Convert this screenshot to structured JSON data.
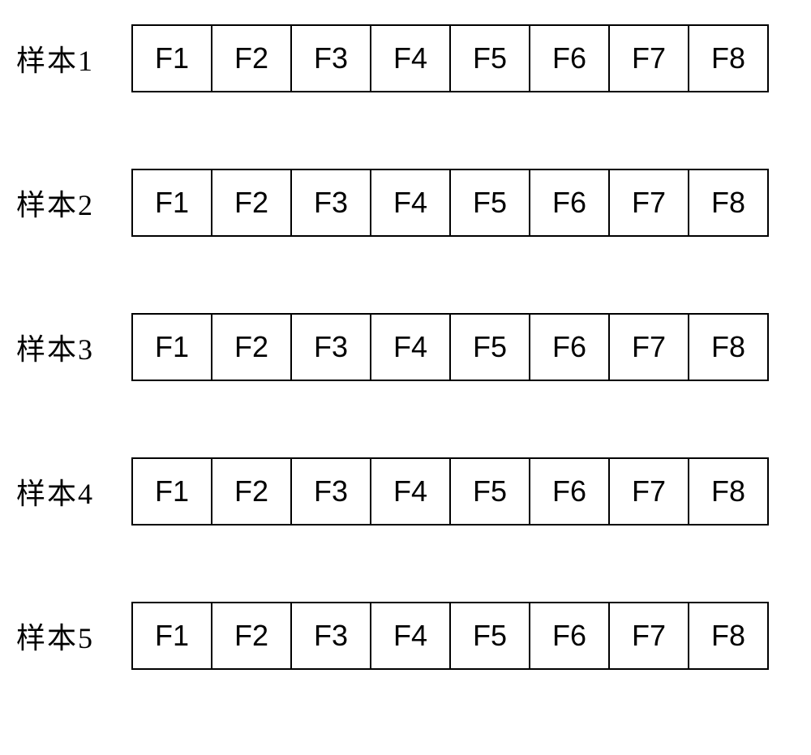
{
  "samples": [
    {
      "label": "样本1",
      "cells": [
        "F1",
        "F2",
        "F3",
        "F4",
        "F5",
        "F6",
        "F7",
        "F8"
      ]
    },
    {
      "label": "样本2",
      "cells": [
        "F1",
        "F2",
        "F3",
        "F4",
        "F5",
        "F6",
        "F7",
        "F8"
      ]
    },
    {
      "label": "样本3",
      "cells": [
        "F1",
        "F2",
        "F3",
        "F4",
        "F5",
        "F6",
        "F7",
        "F8"
      ]
    },
    {
      "label": "样本4",
      "cells": [
        "F1",
        "F2",
        "F3",
        "F4",
        "F5",
        "F6",
        "F7",
        "F8"
      ]
    },
    {
      "label": "样本5",
      "cells": [
        "F1",
        "F2",
        "F3",
        "F4",
        "F5",
        "F6",
        "F7",
        "F8"
      ]
    }
  ]
}
